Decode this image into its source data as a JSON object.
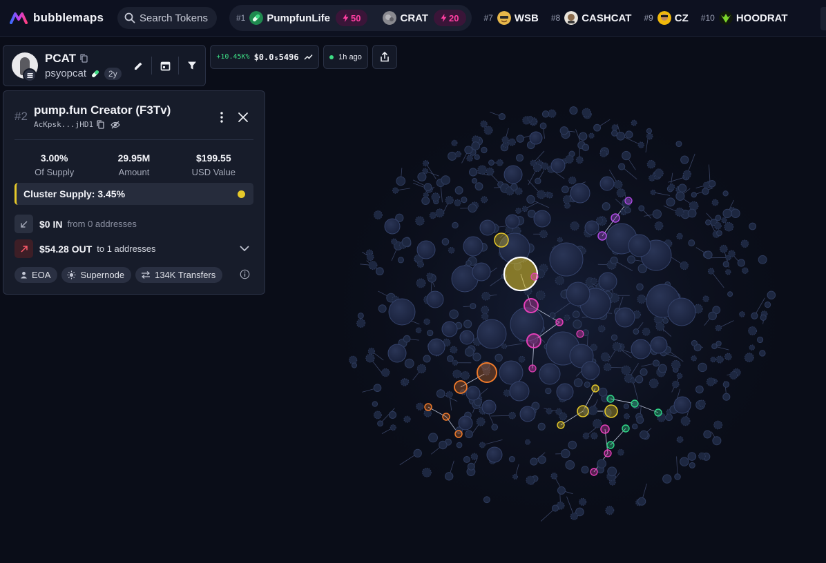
{
  "app": {
    "name": "bubblemaps",
    "accent": "#e6c92a"
  },
  "search": {
    "placeholder": "Search Tokens"
  },
  "trending": [
    {
      "rank": "#1",
      "name": "PumpfunLife",
      "boost": "50",
      "icon": "pill-icon",
      "color": "#3ddc84"
    },
    {
      "rank": "",
      "name": "CRAT",
      "boost": "20",
      "icon": "crat-avatar-icon",
      "color": "#7a7a80"
    },
    {
      "rank": "#7",
      "name": "WSB",
      "icon": "wsb-avatar-icon",
      "color": "#e8b84a"
    },
    {
      "rank": "#8",
      "name": "CASHCAT",
      "icon": "cashcat-avatar-icon",
      "color": "#e9e5dc"
    },
    {
      "rank": "#9",
      "name": "CZ",
      "icon": "cz-avatar-icon",
      "color": "#f0b90b"
    },
    {
      "rank": "#10",
      "name": "HOODRAT",
      "icon": "hoodrat-avatar-icon",
      "color": "#2e3b1c"
    }
  ],
  "token": {
    "symbol": "PCAT",
    "name": "psyopcat",
    "age": "2y",
    "price_change": "+10.45K%",
    "price": "$0.0₅5496",
    "updated": "1h ago"
  },
  "holder": {
    "rank": "#2",
    "title": "pump.fun Creator (F3Tv)",
    "address": "AcKpsk...jHD1",
    "stats": [
      {
        "value": "3.00%",
        "label": "Of Supply"
      },
      {
        "value": "29.95M",
        "label": "Amount"
      },
      {
        "value": "$199.55",
        "label": "USD Value"
      }
    ],
    "cluster_supply": "Cluster Supply: 3.45%",
    "in_amount": "$0 IN",
    "in_desc": "from 0 addresses",
    "out_amount": "$54.28 OUT",
    "out_desc": "to 1 addresses",
    "tags": [
      "EOA",
      "Supernode",
      "134K Transfers"
    ]
  },
  "graph": {
    "colors": {
      "node": "#1d2740",
      "node_stroke": "#2e3b5c",
      "selected": "#e6c92a",
      "magenta": "#e43fb8",
      "orange": "#f07a2a",
      "green": "#2fd687",
      "purple": "#b24ce8"
    }
  }
}
